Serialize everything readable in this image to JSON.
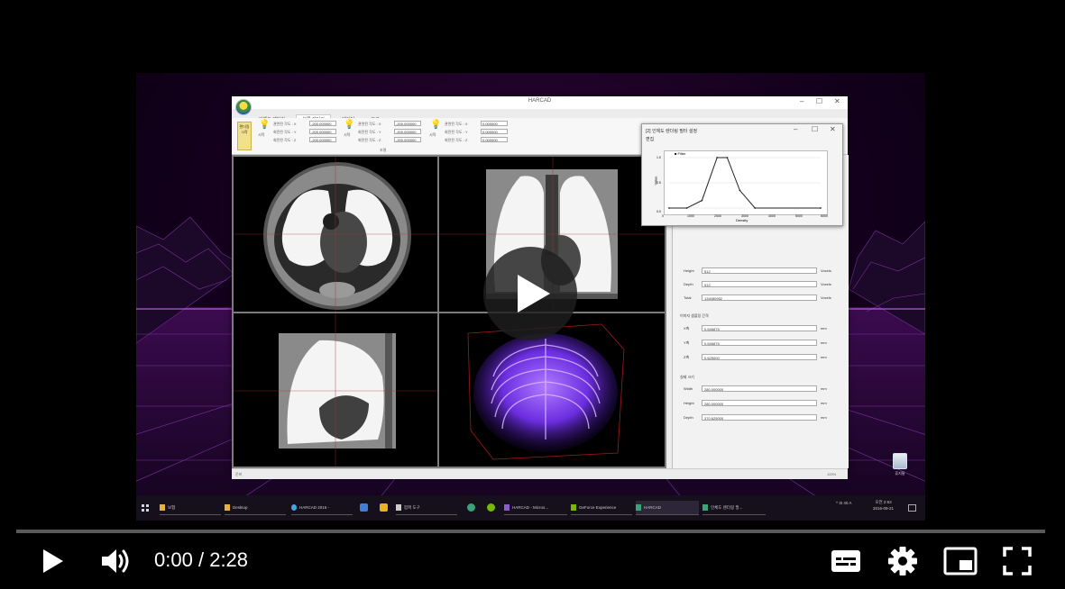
{
  "player": {
    "current_time": "0:00",
    "time_separator": "/",
    "duration": "2:28",
    "progress": 0,
    "accent_color": "#ff0000",
    "icons": [
      "play-icon",
      "volume-icon",
      "subtitles-icon",
      "settings-icon",
      "miniplayer-icon",
      "fullscreen-icon",
      "big-play-icon"
    ]
  },
  "app": {
    "title": "HARCAD",
    "window_controls": [
      "–",
      "☐",
      "✕"
    ],
    "ribbon_tabs": [
      "인체도 렌더링",
      "볼륨 렌더링",
      "데이터",
      "도구"
    ],
    "ribbon": {
      "big_button_label": "렌더링 시작",
      "groups": [
        {
          "label": "시작",
          "fields": [
            {
              "label": "관련된 각도 : X",
              "value": "-200.000000"
            },
            {
              "label": "회전된 각도 : Y",
              "value": "-200.000000"
            },
            {
              "label": "회전된 각도 : Z",
              "value": "-200.000000"
            }
          ]
        },
        {
          "label": "시작",
          "fields": [
            {
              "label": "관련된 각도 : X",
              "value": "-200.000000"
            },
            {
              "label": "회전된 각도 : Y",
              "value": "-200.000000"
            },
            {
              "label": "회전된 각도 : Z",
              "value": "-200.000000"
            }
          ]
        },
        {
          "label": "시작",
          "fields": [
            {
              "label": "관련된 각도 : X",
              "value": "0.000000"
            },
            {
              "label": "회전된 각도 : Y",
              "value": "0.000000"
            },
            {
              "label": "회전된 각도 : Z",
              "value": "0.000000"
            }
          ]
        }
      ],
      "center_label": "조명"
    },
    "properties": {
      "volume_rows": [
        {
          "label": "Height",
          "value": "512",
          "unit": "Voxels"
        },
        {
          "label": "Depth",
          "value": "512",
          "unit": "Voxels"
        },
        {
          "label": "Total",
          "value": "134080952",
          "unit": "Voxels"
        }
      ],
      "spacing_title": "이미지 샘플링 간격",
      "spacing_rows": [
        {
          "label": "X축",
          "value": "0.546875",
          "unit": "mm"
        },
        {
          "label": "Y축",
          "value": "0.546875",
          "unit": "mm"
        },
        {
          "label": "Z축",
          "value": "0.625000",
          "unit": "mm"
        }
      ],
      "size_title": "실제 크기",
      "size_rows": [
        {
          "label": "Width",
          "value": "280.000000",
          "unit": "mm"
        },
        {
          "label": "Height",
          "value": "280.000000",
          "unit": "mm"
        },
        {
          "label": "Depth",
          "value": "370.625000",
          "unit": "mm"
        }
      ]
    },
    "status_left": "준비",
    "status_right": "100%"
  },
  "tf_dialog": {
    "title": "[2] 인체도 렌더링 필터 설정",
    "menu": "편집",
    "window_controls": [
      "–",
      "☐",
      "✕"
    ],
    "legend": "■ Filter",
    "xlabel": "Density",
    "ylabel": "Value",
    "x_ticks": [
      "0",
      "1000",
      "2000",
      "3000",
      "4000",
      "5000",
      "6000"
    ],
    "y_ticks": [
      "0.0",
      "0.5",
      "1.0"
    ]
  },
  "chart_data": {
    "type": "line",
    "title": "",
    "xlabel": "Density",
    "ylabel": "Value",
    "xlim": [
      0,
      6000
    ],
    "ylim": [
      0,
      1
    ],
    "series": [
      {
        "name": "Filter",
        "x": [
          0,
          700,
          1300,
          1900,
          2300,
          2800,
          3400,
          6000
        ],
        "y": [
          0,
          0,
          0.15,
          1,
          1,
          0.35,
          0,
          0
        ]
      }
    ]
  },
  "desktop": {
    "recycle_bin_label": "휴지통"
  },
  "taskbar": {
    "items": [
      {
        "label": "보험",
        "color": "#e3b341"
      },
      {
        "label": "Desktop",
        "color": "#e3b341"
      },
      {
        "label": "HARCAD 2016 -",
        "color": "#4aa3df"
      },
      {
        "label": "HARCAD - Micros...",
        "color": "#8a5cc7"
      },
      {
        "label": "GeForce Experience",
        "color": "#76b900"
      },
      {
        "label": "HARCAD",
        "color": "#3aa37a"
      },
      {
        "label": "인체도 렌더링 필...",
        "color": "#3aa37a"
      }
    ],
    "pinned_label": "팜퍼 도구",
    "tray_text": "^ ⊡ 40 A",
    "clock_time": "오전 2:53",
    "clock_date": "2016-09-21"
  }
}
